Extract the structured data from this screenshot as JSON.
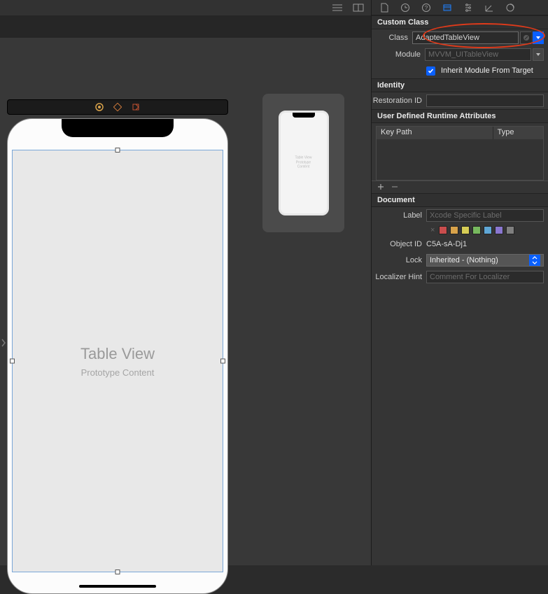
{
  "canvas": {
    "tableview_title": "Table View",
    "tableview_subtitle": "Prototype Content"
  },
  "inspector": {
    "custom_class": {
      "header": "Custom Class",
      "class_label": "Class",
      "class_value": "AdaptedTableView",
      "module_label": "Module",
      "module_placeholder": "MVVM_UITableView",
      "inherit_label": "Inherit Module From Target",
      "inherit_checked": true
    },
    "identity": {
      "header": "Identity",
      "restoration_label": "Restoration ID",
      "restoration_value": ""
    },
    "udra": {
      "header": "User Defined Runtime Attributes",
      "col_keypath": "Key Path",
      "col_type": "Type"
    },
    "document": {
      "header": "Document",
      "label_label": "Label",
      "label_placeholder": "Xcode Specific Label",
      "swatches": [
        "#c94d4d",
        "#d8a24a",
        "#d6cc55",
        "#77b85e",
        "#5fa7d6",
        "#8a77d0",
        "#7f7f7f"
      ],
      "objectid_label": "Object ID",
      "objectid_value": "C5A-sA-Dj1",
      "lock_label": "Lock",
      "lock_value": "Inherited - (Nothing)",
      "locnote_label": "Localizer Hint",
      "locnote_placeholder": "Comment For Localizer"
    }
  }
}
